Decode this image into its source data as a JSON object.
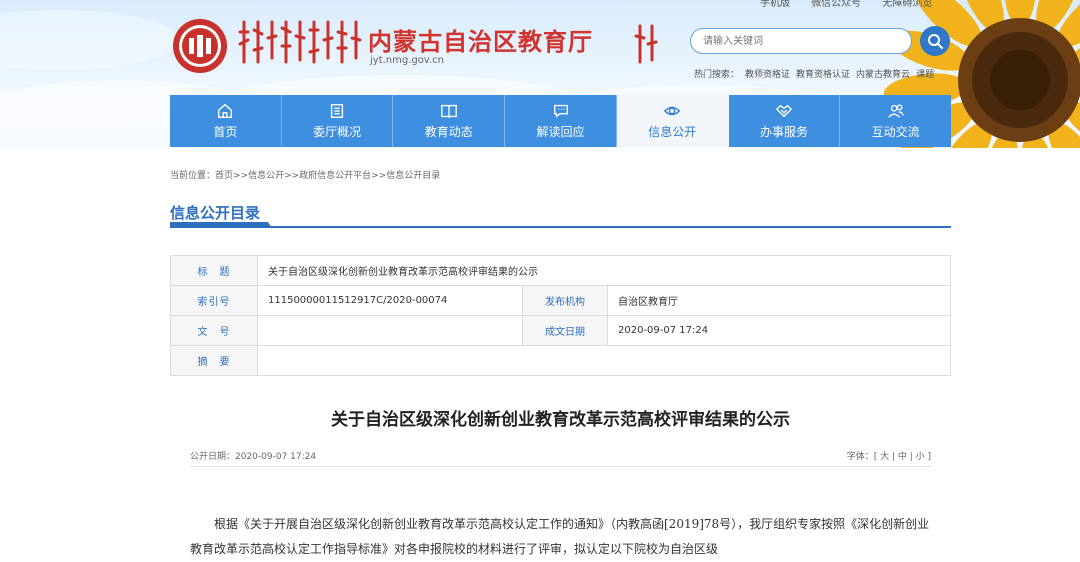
{
  "header": {
    "top_links": [
      "手机版",
      "微信公众号",
      "无障碍浏览"
    ],
    "site_title": "内蒙古自治区教育厅",
    "site_domain": "jyt.nmg.gov.cn",
    "search_placeholder": "请输入关键词",
    "hot_search_label": "热门搜索：",
    "hot_search_items": [
      "教师资格证",
      "教育资格认证",
      "内蒙古教育云",
      "课题"
    ]
  },
  "nav": {
    "items": [
      {
        "label": "首页",
        "icon": "home-icon"
      },
      {
        "label": "委厅概况",
        "icon": "list-icon"
      },
      {
        "label": "教育动态",
        "icon": "book-icon"
      },
      {
        "label": "解读回应",
        "icon": "chat-icon"
      },
      {
        "label": "信息公开",
        "icon": "eye-icon",
        "active": true
      },
      {
        "label": "办事服务",
        "icon": "handshake-icon"
      },
      {
        "label": "互动交流",
        "icon": "users-icon"
      }
    ]
  },
  "breadcrumb": "当前位置：首页>>信息公开>>政府信息公开平台>>信息公开目录",
  "section_title": "信息公开目录",
  "info": {
    "title_label": "标　题",
    "title_value": "关于自治区级深化创新创业教育改革示范高校评审结果的公示",
    "index_label": "索引号",
    "index_value": "11150000011512917C/2020-00074",
    "publisher_label": "发布机构",
    "publisher_value": "自治区教育厅",
    "doc_no_label": "文　号",
    "doc_no_value": "",
    "date_label": "成文日期",
    "date_value": "2020-09-07 17:24",
    "abstract_label": "摘　要",
    "abstract_value": ""
  },
  "article": {
    "title": "关于自治区级深化创新创业教育改革示范高校评审结果的公示",
    "publish_date": "公开日期：2020-09-07 17:24",
    "font_size": "字体：[ 大 | 中 | 小 ]",
    "paragraph": "根据《关于开展自治区级深化创新创业教育改革示范高校认定工作的通知》（内教高函[2019]78号），我厅组织专家按照《深化创新创业教育改革示范高校认定工作指导标准》对各申报院校的材料进行了评审，拟认定以下院校为自治区级"
  },
  "colors": {
    "nav_bg": "#3e8fe0",
    "title_red": "#d1332e",
    "accent_blue": "#2e6fbf"
  }
}
